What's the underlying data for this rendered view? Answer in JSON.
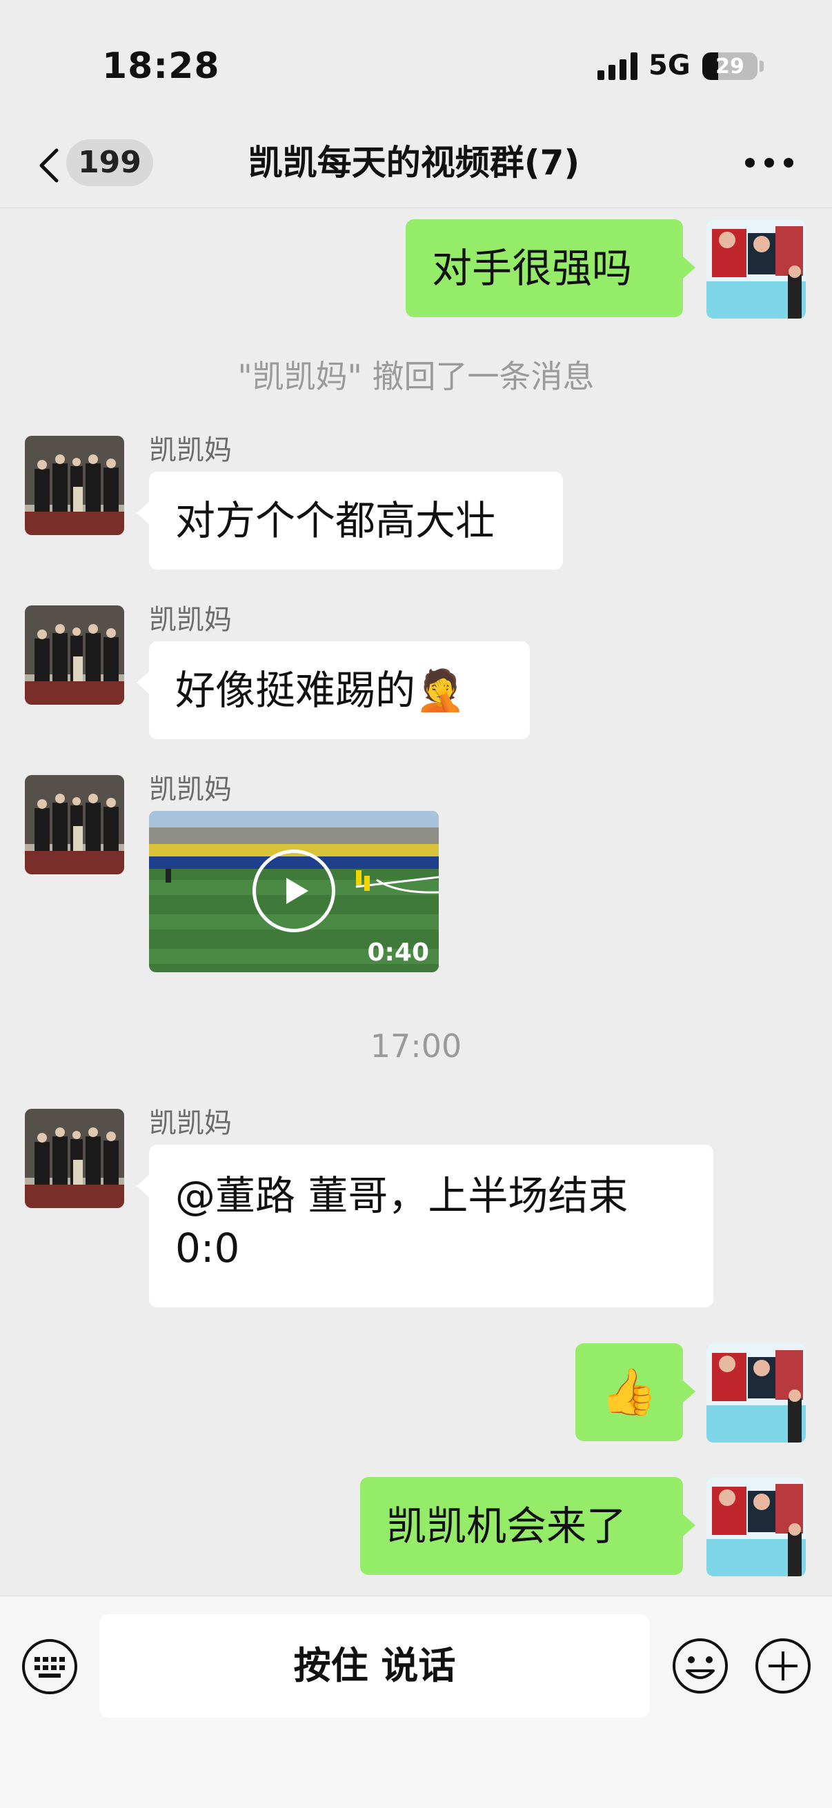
{
  "status_bar": {
    "time": "18:28",
    "network": "5G",
    "battery": "29",
    "battery_level": 0.29
  },
  "header": {
    "unread_count": "199",
    "title": "凯凯每天的视频群(7)"
  },
  "messages": {
    "m1": {
      "text": "对手很强吗"
    },
    "recall_notice": "\"凯凯妈\" 撤回了一条消息",
    "m2": {
      "sender": "凯凯妈",
      "text": "对方个个都高大壮"
    },
    "m3": {
      "sender": "凯凯妈",
      "text": "好像挺难踢的",
      "emoji": "🤦"
    },
    "m4": {
      "sender": "凯凯妈",
      "duration": "0:40"
    },
    "timestamp": "17:00",
    "m5": {
      "sender": "凯凯妈",
      "line1": "@董路 董哥，上半场结束",
      "line2": "0:0"
    },
    "m6": {
      "emoji": "👍"
    },
    "m7": {
      "text": "凯凯机会来了"
    }
  },
  "input_bar": {
    "hold_to_talk": "按住 说话"
  },
  "colors": {
    "background": "#ededed",
    "outgoing_bubble": "#95ec69",
    "incoming_bubble": "#ffffff"
  }
}
